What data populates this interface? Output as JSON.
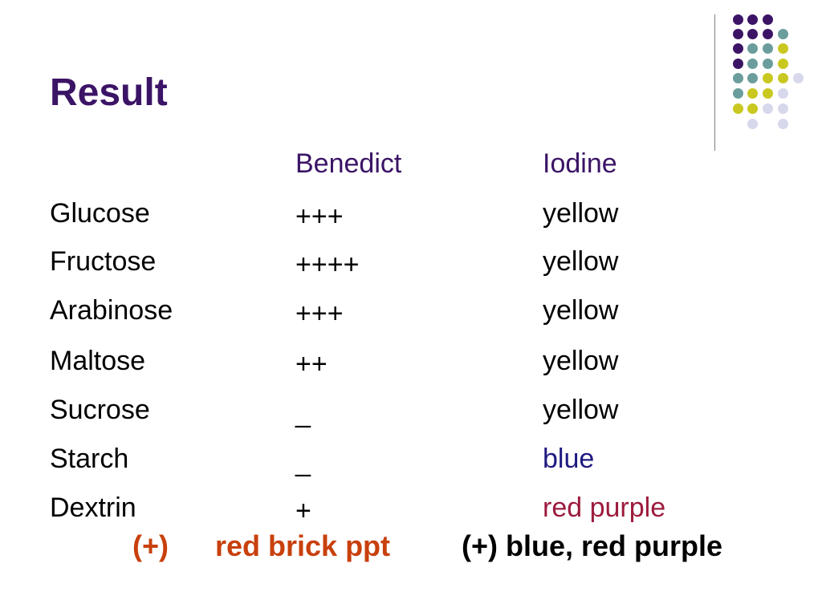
{
  "title": "Result",
  "headers": {
    "benedict": "Benedict",
    "iodine": "Iodine"
  },
  "rows": [
    {
      "sugar": "Glucose",
      "benedict": "+++",
      "iodine": "yellow"
    },
    {
      "sugar": "Fructose",
      "benedict": "++++",
      "iodine": "yellow"
    },
    {
      "sugar": "Arabinose",
      "benedict": "+++",
      "iodine": "yellow"
    },
    {
      "sugar": "Maltose",
      "benedict": "++",
      "iodine": "yellow"
    },
    {
      "sugar": "Sucrose",
      "benedict": "_",
      "iodine": "yellow"
    },
    {
      "sugar": "Starch",
      "benedict": "_",
      "iodine": "blue"
    },
    {
      "sugar": "Dextrin",
      "benedict": "+",
      "iodine": "red purple"
    }
  ],
  "legend": {
    "benedict_sign": "(+)",
    "benedict_meaning": "red brick ppt",
    "iodine_meaning": "(+) blue, red purple"
  },
  "colors": {
    "title": "#3b1466",
    "blue_text": "#1f1a80",
    "red_purple_text": "#9c1b3d",
    "orange_text": "#c8400c",
    "dot_purple": "#3b1466",
    "dot_teal": "#6b9d9d",
    "dot_lime": "#c9c820",
    "dot_lavender": "#d8d8ec"
  }
}
